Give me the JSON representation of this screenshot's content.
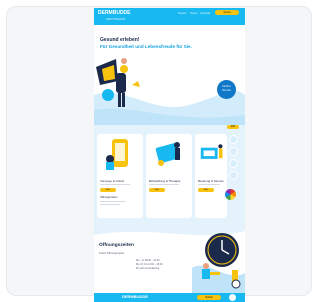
{
  "header": {
    "logo": "DERMBUDDE",
    "logo_sub": "ARZTPRAXIS",
    "links": [
      "Praxis",
      "Team",
      "Kontakt"
    ],
    "cta": "Termin"
  },
  "hero": {
    "title": "Gesund erleben!",
    "subtitle": "Für Gesundheit und Lebensfreude für Sie.",
    "badge_line1": "Online",
    "badge_line2": "Termin"
  },
  "cards": [
    {
      "label": "Vorsorge & Check",
      "button": "Mehr",
      "note": "Öffnungszeiten"
    },
    {
      "label": "Behandlung & Therapie",
      "button": "Mehr",
      "note": ""
    },
    {
      "label": "Beratung & Service",
      "button": "Mehr",
      "note": ""
    }
  ],
  "side_tag": "Info",
  "hours": {
    "title": "Öffnungszeiten",
    "text": "Praxis Öffnungszeiten",
    "rows": [
      "Mo – Fr  08:00 – 12:00",
      "Mo, Di, Do  14:00 – 18:00",
      "Mi  nach Vereinbarung"
    ]
  },
  "footer": {
    "logo": "DERMBUDDE",
    "cta": "Termin"
  },
  "colors": {
    "brand_blue": "#18b8f0",
    "accent_yellow": "#f8c30f",
    "dark_navy": "#1b2a4a"
  }
}
